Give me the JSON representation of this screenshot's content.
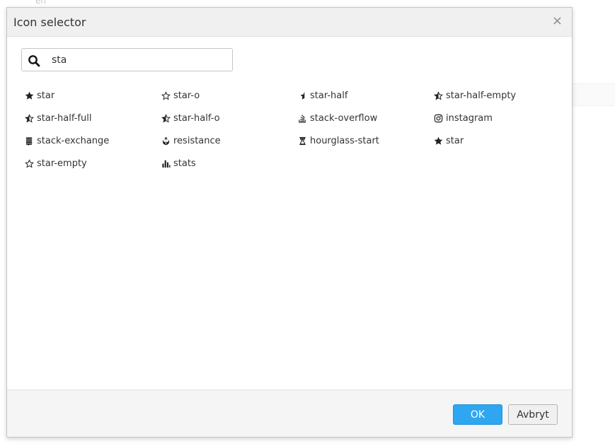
{
  "background": {
    "text": "en"
  },
  "dialog": {
    "title": "Icon selector",
    "close_label": "×",
    "search": {
      "value": "sta",
      "placeholder": ""
    },
    "icons": [
      {
        "name": "star",
        "icon": "star-icon"
      },
      {
        "name": "star-o",
        "icon": "star-outline-icon"
      },
      {
        "name": "star-half",
        "icon": "star-half-icon"
      },
      {
        "name": "star-half-empty",
        "icon": "star-half-empty-icon"
      },
      {
        "name": "star-half-full",
        "icon": "star-half-full-icon"
      },
      {
        "name": "star-half-o",
        "icon": "star-half-o-icon"
      },
      {
        "name": "stack-overflow",
        "icon": "stack-overflow-icon"
      },
      {
        "name": "instagram",
        "icon": "instagram-icon"
      },
      {
        "name": "stack-exchange",
        "icon": "stack-exchange-icon"
      },
      {
        "name": "resistance",
        "icon": "resistance-icon"
      },
      {
        "name": "hourglass-start",
        "icon": "hourglass-start-icon"
      },
      {
        "name": "star",
        "icon": "star-icon"
      },
      {
        "name": "star-empty",
        "icon": "star-empty-icon"
      },
      {
        "name": "stats",
        "icon": "stats-icon"
      }
    ],
    "buttons": {
      "ok": "OK",
      "cancel": "Avbryt"
    },
    "colors": {
      "primary": "#2ea6f0",
      "header_bg": "#f0f0f0",
      "footer_bg": "#f5f5f5"
    }
  }
}
